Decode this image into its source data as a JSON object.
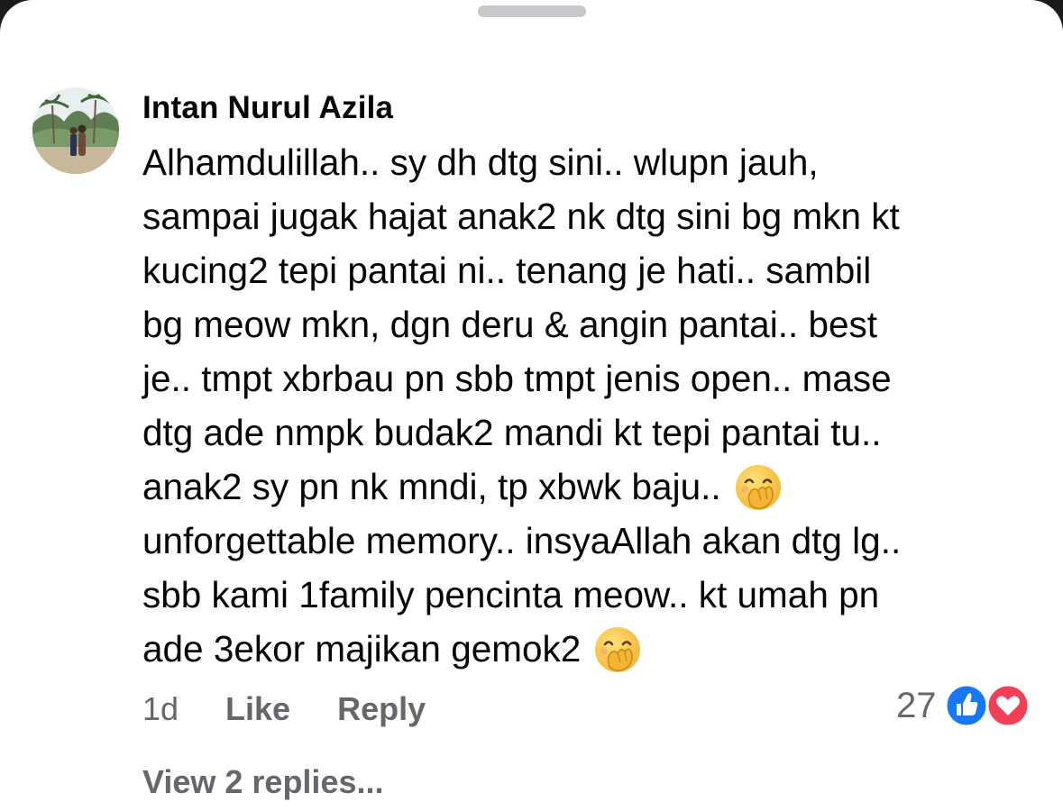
{
  "comment": {
    "author": "Intan Nurul Azila",
    "lines": [
      "Alhamdulillah.. sy dh dtg sini.. wlupn jauh,",
      "sampai jugak hajat anak2 nk dtg sini bg mkn kt",
      "kucing2 tepi pantai ni.. tenang je hati.. sambil",
      "bg meow mkn, dgn deru & angin pantai.. best",
      "je.. tmpt xbrbau pn sbb tmpt jenis open.. mase",
      "dtg ade nmpk budak2 mandi kt tepi pantai tu..",
      "anak2 sy pn nk mndi, tp xbwk baju..",
      "unforgettable memory.. insyaAllah akan dtg lg..",
      "sbb kami 1family pencinta meow.. kt umah pn",
      "ade 3ekor majikan gemok2"
    ],
    "emoji_name": "face-with-hand-over-mouth-icon"
  },
  "actions": {
    "time": "1d",
    "like_label": "Like",
    "reply_label": "Reply"
  },
  "reactions": {
    "count": "27",
    "types": [
      "like-icon",
      "love-icon"
    ],
    "colors": {
      "like": "#1877f2",
      "love": "#f33e58"
    }
  },
  "replies": {
    "label": "View 2 replies..."
  },
  "colors": {
    "text": "#050505",
    "secondary": "#65676b",
    "background": "#ffffff"
  }
}
